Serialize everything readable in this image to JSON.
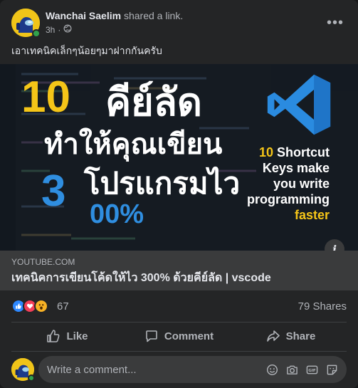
{
  "post": {
    "author": "Wanchai Saelim",
    "action": "shared a link.",
    "time": "3h",
    "audience_icon": "globe-icon",
    "text": "เอาเทคนิคเล็กๆน้อยๆมาฝากกันครับ"
  },
  "thumbnail": {
    "headline_num": "10",
    "headline_thai": "คีย์ลัด",
    "line2_thai": "ทำให้คุณเขียน",
    "line3_thai": "โปรแกรมไว",
    "big_three": "3",
    "percent_text": "00%",
    "english_lines": [
      {
        "num": "10",
        "text": " Shortcut"
      },
      {
        "text": "Keys make"
      },
      {
        "text": "you write"
      },
      {
        "text": "programming"
      },
      {
        "text": "faster",
        "highlight": true
      }
    ]
  },
  "link": {
    "domain": "YOUTUBE.COM",
    "title": "เทคนิคการเขียนโค้ดให้ไว 300% ด้วยคีย์ลัด | vscode"
  },
  "reactions": {
    "icons": [
      "like-icon",
      "love-icon",
      "wow-icon"
    ],
    "count": "67",
    "shares": "79 Shares"
  },
  "actions": {
    "like": "Like",
    "comment": "Comment",
    "share": "Share"
  },
  "comment": {
    "placeholder": "Write a comment...",
    "tools": [
      "emoji-icon",
      "camera-icon",
      "gif-icon",
      "sticker-icon"
    ]
  },
  "colors": {
    "background": "#242526",
    "link_box": "#3a3b3c",
    "accent_blue": "#2d88ff",
    "yellow": "#f5c518"
  }
}
